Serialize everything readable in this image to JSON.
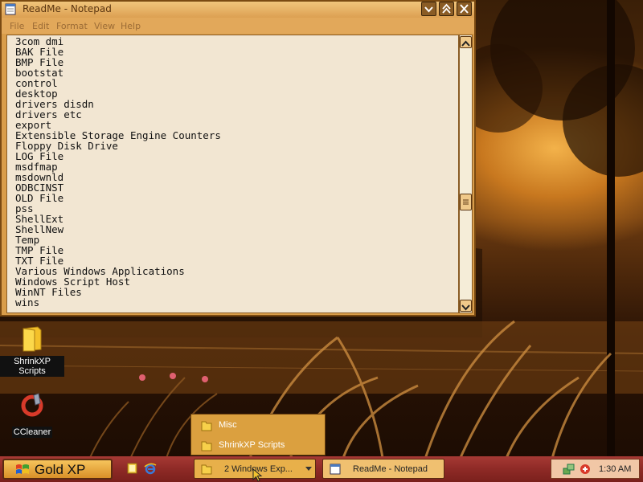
{
  "window": {
    "title": "ReadMe - Notepad",
    "buttons": [
      "minimize",
      "maximize",
      "close"
    ]
  },
  "menu": [
    "File",
    "Edit",
    "Format",
    "View",
    "Help"
  ],
  "document": {
    "lines": [
      "3com dmi",
      "BAK File",
      "BMP File",
      "bootstat",
      "control",
      "desktop",
      "drivers disdn",
      "drivers etc",
      "export",
      "Extensible Storage Engine Counters",
      "Floppy Disk Drive",
      "LOG File",
      "msdfmap",
      "msdownld",
      "ODBCINST",
      "OLD File",
      "pss",
      "ShellExt",
      "ShellNew",
      "Temp",
      "TMP File",
      "TXT File",
      "Various Windows Applications",
      "Windows Script Host",
      "WinNT Files",
      "wins"
    ]
  },
  "desktop_icons": [
    {
      "label": "ShrinkXP Scripts",
      "icon": "folder-icon"
    },
    {
      "label": "CCleaner",
      "icon": "ccleaner-icon"
    }
  ],
  "group_popup": {
    "items": [
      "Misc",
      "ShrinkXP Scripts"
    ]
  },
  "taskbar": {
    "start_label": "Gold XP",
    "tasks": [
      "2 Windows Exp...",
      "ReadMe - Notepad"
    ],
    "clock": "1:30 AM"
  },
  "colors": {
    "titlebar": "#dca052",
    "taskbar": "#8e2a26",
    "accent": "#f6c45c",
    "text_area": "#f2e6d2"
  }
}
